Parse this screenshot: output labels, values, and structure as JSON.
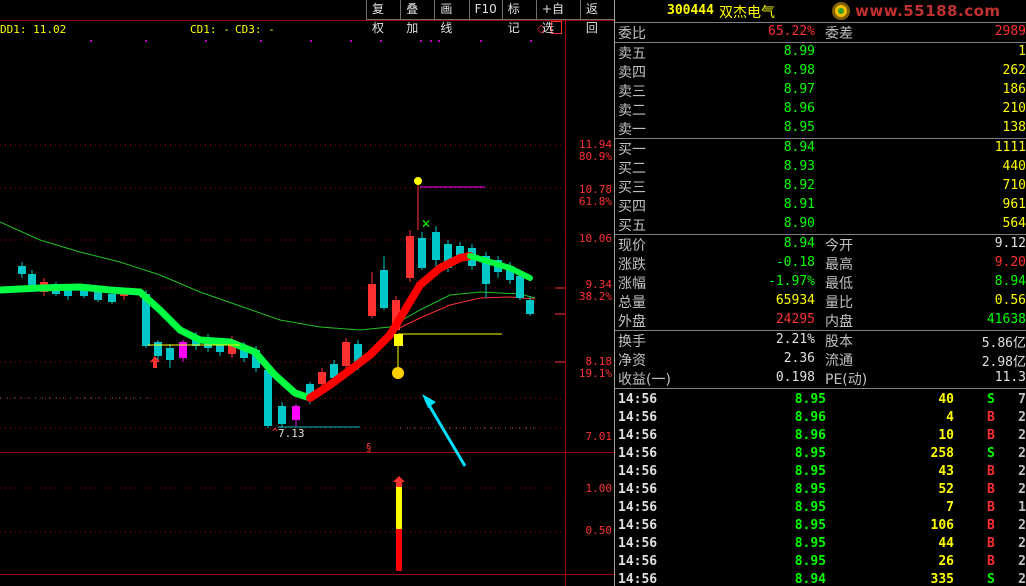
{
  "toolbar": {
    "buttons": [
      "复权",
      "叠加",
      "画线",
      "F10",
      "标记",
      "+自选",
      "返回"
    ]
  },
  "indicators": {
    "dd1_label": "DD1: 11.02",
    "cd1_label": "CD1: -",
    "cd3_label": "CD3: -"
  },
  "price_axis": {
    "labels": [
      {
        "price": "11.94",
        "pct": "80.9%"
      },
      {
        "price": "10.78",
        "pct": "61.8%"
      },
      {
        "price": "10.06",
        "pct": ""
      },
      {
        "price": "9.34",
        "pct": "38.2%"
      },
      {
        "price": "8.18",
        "pct": "19.1%"
      },
      {
        "price": "7.01",
        "pct": ""
      }
    ],
    "low_marker": "7.13",
    "sub_labels": [
      "1.00",
      "0.50"
    ]
  },
  "colors": {
    "up": "#ff3030",
    "down": "#00c8c8",
    "ma": "#20c020",
    "band_up": "#ff0000",
    "band_down": "#00ff40",
    "accent": "#ffff00",
    "arrow": "#00e0ff"
  },
  "header": {
    "code": "300444",
    "name": "双杰电气",
    "logo": "www.55188.com"
  },
  "ratio": {
    "label": "委比",
    "value": "65.22%",
    "label2": "委差",
    "value2": "2989"
  },
  "sell": [
    {
      "label": "卖五",
      "price": "8.99",
      "vol": "1"
    },
    {
      "label": "卖四",
      "price": "8.98",
      "vol": "262"
    },
    {
      "label": "卖三",
      "price": "8.97",
      "vol": "186"
    },
    {
      "label": "卖二",
      "price": "8.96",
      "vol": "210"
    },
    {
      "label": "卖一",
      "price": "8.95",
      "vol": "138"
    }
  ],
  "buy": [
    {
      "label": "买一",
      "price": "8.94",
      "vol": "1111"
    },
    {
      "label": "买二",
      "price": "8.93",
      "vol": "440"
    },
    {
      "label": "买三",
      "price": "8.92",
      "vol": "710"
    },
    {
      "label": "买四",
      "price": "8.91",
      "vol": "961"
    },
    {
      "label": "买五",
      "price": "8.90",
      "vol": "564"
    }
  ],
  "stats1": [
    {
      "l": "现价",
      "v": "8.94",
      "vc": "green",
      "l2": "今开",
      "v2": "9.12",
      "v2c": "white"
    },
    {
      "l": "涨跌",
      "v": "-0.18",
      "vc": "green",
      "l2": "最高",
      "v2": "9.20",
      "v2c": "red"
    },
    {
      "l": "涨幅",
      "v": "-1.97%",
      "vc": "green",
      "l2": "最低",
      "v2": "8.94",
      "v2c": "green"
    },
    {
      "l": "总量",
      "v": "65934",
      "vc": "yellow",
      "l2": "量比",
      "v2": "0.56",
      "v2c": "yellow"
    },
    {
      "l": "外盘",
      "v": "24295",
      "vc": "red",
      "l2": "内盘",
      "v2": "41638",
      "v2c": "green"
    }
  ],
  "stats2": [
    {
      "l": "换手",
      "v": "2.21%",
      "vc": "white",
      "l2": "股本",
      "v2": "5.86亿",
      "v2c": "white"
    },
    {
      "l": "净资",
      "v": "2.36",
      "vc": "white",
      "l2": "流通",
      "v2": "2.98亿",
      "v2c": "white"
    },
    {
      "l": "收益(一)",
      "v": "0.198",
      "vc": "white",
      "l2": "PE(动)",
      "v2": "11.3",
      "v2c": "white"
    }
  ],
  "ticks": [
    {
      "time": "14:56",
      "price": "8.95",
      "vol": "40",
      "side": "S",
      "n": "7"
    },
    {
      "time": "14:56",
      "price": "8.96",
      "vol": "4",
      "side": "B",
      "n": "2"
    },
    {
      "time": "14:56",
      "price": "8.96",
      "vol": "10",
      "side": "B",
      "n": "2"
    },
    {
      "time": "14:56",
      "price": "8.95",
      "vol": "258",
      "side": "S",
      "n": "2"
    },
    {
      "time": "14:56",
      "price": "8.95",
      "vol": "43",
      "side": "B",
      "n": "2"
    },
    {
      "time": "14:56",
      "price": "8.95",
      "vol": "52",
      "side": "B",
      "n": "2"
    },
    {
      "time": "14:56",
      "price": "8.95",
      "vol": "7",
      "side": "B",
      "n": "1"
    },
    {
      "time": "14:56",
      "price": "8.95",
      "vol": "106",
      "side": "B",
      "n": "2"
    },
    {
      "time": "14:56",
      "price": "8.95",
      "vol": "44",
      "side": "B",
      "n": "2"
    },
    {
      "time": "14:56",
      "price": "8.95",
      "vol": "26",
      "side": "B",
      "n": "2"
    },
    {
      "time": "14:56",
      "price": "8.94",
      "vol": "335",
      "side": "S",
      "n": "2"
    }
  ]
}
